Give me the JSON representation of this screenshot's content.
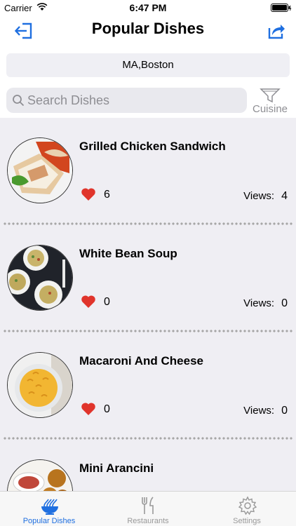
{
  "status_bar": {
    "carrier": "Carrier",
    "time": "6:47 PM"
  },
  "header": {
    "title": "Popular Dishes"
  },
  "location": {
    "text": "MA,Boston"
  },
  "search": {
    "placeholder": "Search Dishes",
    "filter_label": "Cuisine"
  },
  "colors": {
    "accent": "#1f6fe0",
    "heart": "#e0342b",
    "list_bg": "#efeef3"
  },
  "dishes": [
    {
      "name": "Grilled Chicken Sandwich",
      "likes": "6",
      "views_label": "Views:",
      "views": "4"
    },
    {
      "name": "White Bean Soup",
      "likes": "0",
      "views_label": "Views:",
      "views": "0"
    },
    {
      "name": "Macaroni And Cheese",
      "likes": "0",
      "views_label": "Views:",
      "views": "0"
    },
    {
      "name": "Mini Arancini",
      "likes": "",
      "views_label": "",
      "views": ""
    }
  ],
  "tabs": [
    {
      "label": "Popular Dishes",
      "icon": "noodle-bowl-icon",
      "active": true
    },
    {
      "label": "Restaurants",
      "icon": "fork-knife-icon",
      "active": false
    },
    {
      "label": "Settings",
      "icon": "gear-icon",
      "active": false
    }
  ]
}
